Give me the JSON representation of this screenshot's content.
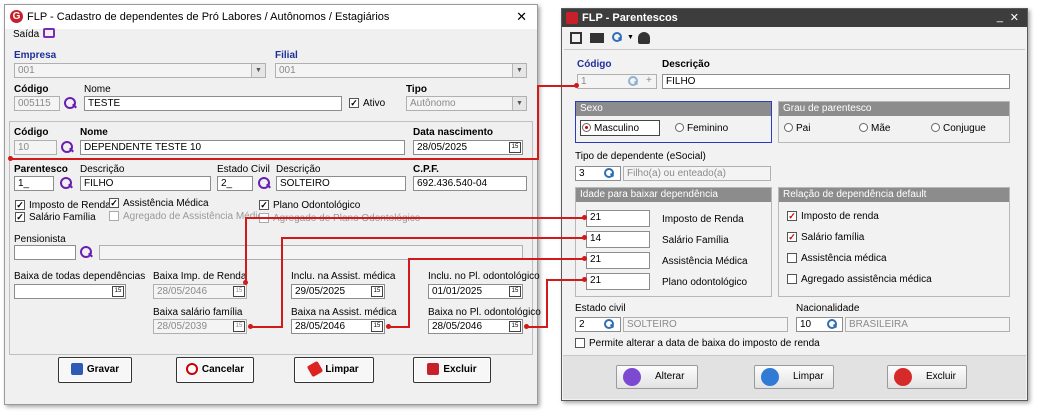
{
  "left_window": {
    "title": "FLP - Cadastro de dependentes de Pró Labores / Autônomos / Estagiários",
    "close": "✕",
    "menu_saida": "Saída",
    "empresa_label": "Empresa",
    "empresa_value": "001",
    "filial_label": "Filial",
    "filial_value": "001",
    "codigo_label": "Código",
    "codigo_value": "005115",
    "nome_label": "Nome",
    "nome_value": "TESTE",
    "ativo_label": "Ativo",
    "tipo_label": "Tipo",
    "tipo_value": "Autônomo",
    "dep_codigo_label": "Código",
    "dep_codigo_value": "10",
    "dep_nome_label": "Nome",
    "dep_nome_value": "DEPENDENTE TESTE 10",
    "nasc_label": "Data nascimento",
    "nasc_value": "28/05/2025",
    "parentesco_label": "Parentesco",
    "parentesco_value": "1_",
    "descricao_label": "Descrição",
    "descricao_value": "FILHO",
    "estado_civil_label": "Estado Civil",
    "estado_civil_value": "2_",
    "descricao2_label": "Descrição",
    "descricao2_value": "SOLTEIRO",
    "cpf_label": "C.P.F.",
    "cpf_value": "692.436.540-04",
    "chk_imposto": "Imposto de Renda",
    "chk_assist": "Assistência Médica",
    "chk_odonto": "Plano Odontológico",
    "chk_salario": "Salário Família",
    "chk_agreg_assist": "Agregado de Assistência Médica",
    "chk_agreg_odonto": "Agregado de Plano Odontológico",
    "pensionista_label": "Pensionista",
    "baixa_todas_label": "Baixa de todas dependências",
    "baixa_imp_label": "Baixa Imp. de Renda",
    "baixa_imp_value": "28/05/2046",
    "incl_assist_label": "Inclu. na Assist. médica",
    "incl_assist_value": "29/05/2025",
    "incl_odonto_label": "Inclu. no Pl. odontológico",
    "incl_odonto_value": "01/01/2025",
    "baixa_sal_label": "Baixa salário família",
    "baixa_sal_value": "28/05/2039",
    "baixa_assist_label": "Baixa na Assist. médica",
    "baixa_assist_value": "28/05/2046",
    "baixa_odonto_label": "Baixa no Pl. odontológico",
    "baixa_odonto_value": "28/05/2046",
    "btn_gravar": "Gravar",
    "btn_cancelar": "Cancelar",
    "btn_limpar": "Limpar",
    "btn_excluir": "Excluir"
  },
  "right_window": {
    "title": "FLP - Parentescos",
    "codigo_label": "Código",
    "codigo_value": "1",
    "descricao_label": "Descrição",
    "descricao_value": "FILHO",
    "sexo_header": "Sexo",
    "masculino": "Masculino",
    "feminino": "Feminino",
    "grau_header": "Grau de parentesco",
    "pai": "Pai",
    "mae": "Mãe",
    "conjugue": "Conjugue",
    "tipo_dep_label": "Tipo de dependente (eSocial)",
    "tipo_dep_code": "3",
    "tipo_dep_desc": "Filho(a) ou enteado(a)",
    "idade_header": "Idade para baixar dependência",
    "idade_imposto_value": "21",
    "idade_imposto_label": "Imposto de Renda",
    "idade_salario_value": "14",
    "idade_salario_label": "Salário Família",
    "idade_assist_value": "21",
    "idade_assist_label": "Assistência Médica",
    "idade_odonto_value": "21",
    "idade_odonto_label": "Plano odontológico",
    "relacao_header": "Relação de dependência default",
    "rel_imposto": "Imposto de renda",
    "rel_salario": "Salário família",
    "rel_assist": "Assistência médica",
    "rel_agreg": "Agregado assistência médica",
    "estado_civil_label": "Estado civil",
    "estado_civil_code": "2",
    "estado_civil_desc": "SOLTEIRO",
    "nacionalidade_label": "Nacionalidade",
    "nacionalidade_code": "10",
    "nacionalidade_desc": "BRASILEIRA",
    "permite_label": "Permite alterar a data de baixa do imposto de renda",
    "btn_alterar": "Alterar",
    "btn_limpar": "Limpar",
    "btn_excluir": "Excluir"
  },
  "colors": {
    "accent_red": "#d21a1a",
    "label_blue": "#1f2f9a",
    "icon_purple": "#6a1fb0"
  }
}
